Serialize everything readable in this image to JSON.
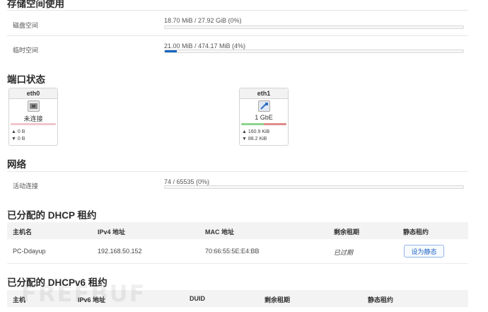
{
  "storage": {
    "title": "存储空间使用",
    "disk": {
      "label": "磁盘空间",
      "value": "18.70 MiB / 27.92 GiB (0%)",
      "percent": 0
    },
    "temp": {
      "label": "临时空间",
      "value": "21.00 MiB / 474.17 MiB (4%)",
      "percent": 4
    }
  },
  "ports": {
    "title": "端口状态",
    "items": [
      {
        "name": "eth0",
        "status": "未连接",
        "tx": "▲ 0 B",
        "rx": "▼ 0 B",
        "connected": false
      },
      {
        "name": "eth1",
        "status": "1 GbE",
        "tx": "▲ 160.9 KiB",
        "rx": "▼ 88.2 KiB",
        "connected": true
      }
    ]
  },
  "network": {
    "title": "网络",
    "active": {
      "label": "活动连接",
      "value": "74 / 65535 (0%)",
      "percent": 0
    }
  },
  "dhcp": {
    "title": "已分配的 DHCP 租约",
    "headers": [
      "主机名",
      "IPv4 地址",
      "MAC 地址",
      "剩余租期",
      "静态租约"
    ],
    "rows": [
      {
        "host": "PC-Ddayup",
        "ipv4": "192.168.50.152",
        "mac": "70:66:55:5E:E4:BB",
        "lease": "已过期",
        "action": "设为静态"
      }
    ]
  },
  "dhcpv6": {
    "title": "已分配的 DHCPv6 租约",
    "headers": [
      "主机",
      "IPv6 地址",
      "DUID",
      "剩余租期",
      "静态租约"
    ]
  },
  "watermark": "FREEBUF",
  "colors": {
    "accent": "#1565c0",
    "link_green": "#8fd48f",
    "link_red": "#e08a8a",
    "idle": "#f0c6cc"
  }
}
